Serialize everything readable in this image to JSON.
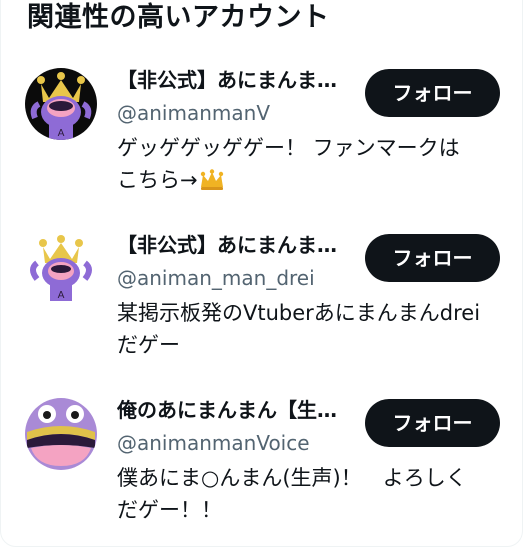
{
  "section": {
    "title": "関連性の高いアカウント"
  },
  "accounts": [
    {
      "name": "【非公式】あにまんまんV",
      "handle": "@animanmanV",
      "bio_line1": "ゲッゲゲッゲゲー！ ファンマークは",
      "bio_line2": "こちら→",
      "bio_emoji": "crown-emoji",
      "follow_label": "フォロー"
    },
    {
      "name": "【非公式】あにまんまんdrei",
      "handle": "@animan_man_drei",
      "bio_line1": "某掲示板発のVtuberあにまんまんdrei",
      "bio_line2": "だゲー",
      "follow_label": "フォロー"
    },
    {
      "name": "俺のあにまんまん【生声】",
      "handle": "@animanmanVoice",
      "bio_line1": "僕あにま○んまん(生声)！　よろしく",
      "bio_line2": "だゲー！！",
      "follow_label": "フォロー"
    }
  ],
  "colors": {
    "button_bg": "#0f1419",
    "handle_gray": "#536471",
    "avatar_purple": "#8e6bd6"
  }
}
